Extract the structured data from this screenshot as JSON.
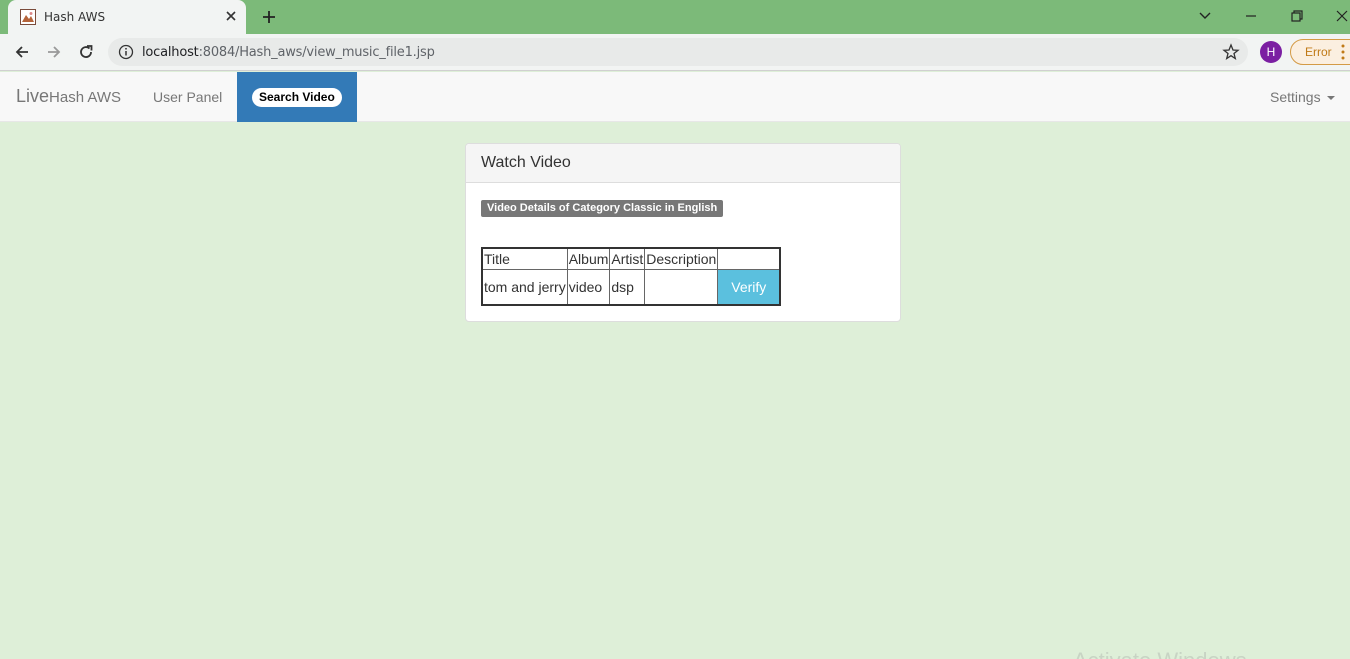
{
  "browser": {
    "tab_title": "Hash AWS",
    "url_host": "localhost",
    "url_rest": ":8084/Hash_aws/view_music_file1.jsp",
    "profile_initial": "H",
    "error_label": "Error"
  },
  "navbar": {
    "brand_big": "Live",
    "brand_small": "Hash AWS",
    "user_panel": "User Panel",
    "search_video": "Search Video",
    "settings": "Settings"
  },
  "panel": {
    "heading": "Watch Video",
    "label": "Video Details of Category Classic in English",
    "columns": [
      "Title",
      "Album",
      "Artist",
      "Description",
      ""
    ],
    "row": {
      "title": "tom and jerry",
      "album": "video",
      "artist": "dsp",
      "description": "",
      "action": "Verify"
    }
  },
  "watermark": "Activate Windows",
  "colors": {
    "page_bg": "#deefd8",
    "tab_strip": "#7cba79",
    "nav_active": "#337ab7",
    "verify": "#5bc0de"
  }
}
